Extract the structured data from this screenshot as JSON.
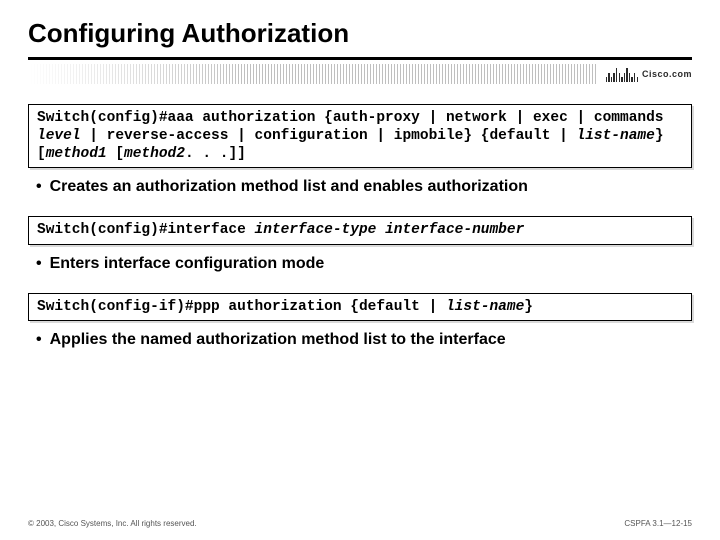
{
  "title": "Configuring Authorization",
  "brand": "Cisco.com",
  "codebox1": {
    "prefix": "Switch(config)#aaa authorization {auth-proxy | network | exec | commands ",
    "i1": "level",
    "mid1": " | reverse-access | configuration | ipmobile} {default | ",
    "i2": "list-name",
    "mid2": "} [",
    "i3": "method1",
    "mid3": " [",
    "i4": "method2",
    "tail": ". . .]]"
  },
  "bullet1": "Creates an authorization method list and enables authorization",
  "codebox2": {
    "prefix": "Switch(config)#interface ",
    "i1": "interface-type interface-number"
  },
  "bullet2": "Enters interface configuration mode",
  "codebox3": {
    "prefix": "Switch(config-if)#ppp authorization {default | ",
    "i1": "list-name",
    "tail": "}"
  },
  "bullet3": "Applies the named authorization method list to the interface",
  "footer_left": "© 2003, Cisco Systems, Inc. All rights reserved.",
  "footer_right": "CSPFA 3.1—12-15"
}
